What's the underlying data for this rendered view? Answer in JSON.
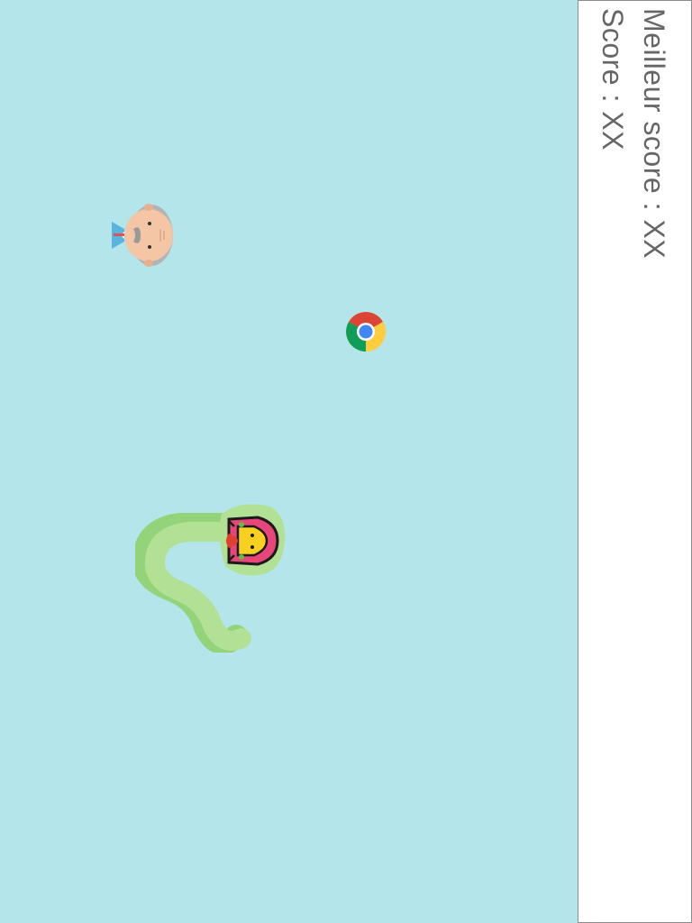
{
  "scoreboard": {
    "best_score_text": "Meilleur score : XX",
    "score_text": "Score : XX"
  },
  "colors": {
    "playfield_background": "#b3e5ea",
    "panel_background": "#ffffff",
    "panel_border": "#8c8c8c",
    "score_text": "#666666",
    "snake_body": "#b2e196",
    "snake_shadow": "#93d47a"
  },
  "sprites": {
    "player": "snake-with-hooded-rider-icon",
    "enemy": "old-man-face-icon",
    "collectible": "chrome-logo-icon"
  }
}
